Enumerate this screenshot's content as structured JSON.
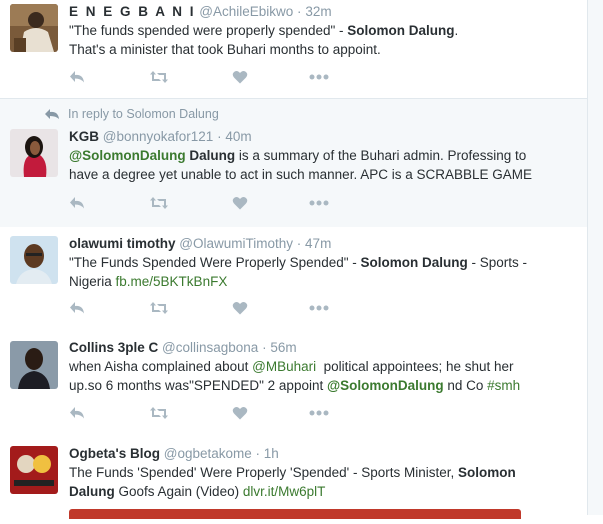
{
  "tweets": [
    {
      "name": "E N E G B A N I",
      "handle": "@AchileEbikwo",
      "dot": "·",
      "time": "32m",
      "lines": [
        {
          "parts": [
            {
              "t": "\"The funds spended were properly spended\" - "
            },
            {
              "b": "Solomon Dalung"
            },
            {
              "t": "."
            }
          ]
        },
        {
          "parts": [
            {
              "t": "That's a minister that took Buhari months to appoint."
            }
          ]
        }
      ]
    },
    {
      "reply_context": "In reply to Solomon Dalung",
      "name": "KGB",
      "handle": "@bonnyokafor121",
      "dot": "·",
      "time": "40m",
      "lines": [
        {
          "parts": [
            {
              "m": "@SolomonDalung"
            },
            {
              "t": " "
            },
            {
              "b": "Dalung"
            },
            {
              "t": " is a summary of the Buhari admin. Professing to"
            }
          ]
        },
        {
          "parts": [
            {
              "t": "have a degree yet unable to act in such manner. APC is a SCRABBLE GAME"
            }
          ]
        }
      ]
    },
    {
      "name": "olawumi timothy",
      "handle": "@OlawumiTimothy",
      "dot": "·",
      "time": "47m",
      "lines": [
        {
          "parts": [
            {
              "t": "\"The Funds Spended Were Properly Spended\" - "
            },
            {
              "b": "Solomon Dalung"
            },
            {
              "t": " - Sports -"
            }
          ]
        },
        {
          "parts": [
            {
              "t": "Nigeria "
            },
            {
              "l": "fb.me/5BKTkBnFX"
            }
          ]
        }
      ]
    },
    {
      "name": "Collins 3ple C",
      "handle": "@collinsagbona",
      "dot": "·",
      "time": "56m",
      "lines": [
        {
          "parts": [
            {
              "t": "when Aisha complained about "
            },
            {
              "l": "@MBuhari"
            },
            {
              "t": "  political appointees; he shut her"
            }
          ]
        },
        {
          "parts": [
            {
              "t": "up.so 6 months was\"SPENDED\" 2 appoint "
            },
            {
              "m": "@SolomonDalung"
            },
            {
              "t": " nd Co "
            },
            {
              "l": "#smh"
            }
          ]
        }
      ]
    },
    {
      "name": "Ogbeta's Blog",
      "handle": "@ogbetakome",
      "dot": "·",
      "time": "1h",
      "lines": [
        {
          "parts": [
            {
              "t": "The Funds 'Spended' Were Properly 'Spended' - Sports Minister, "
            },
            {
              "b": "Solomon"
            }
          ]
        },
        {
          "parts": [
            {
              "b": "Dalung"
            },
            {
              "t": " Goofs Again (Video) "
            },
            {
              "l": "dlvr.it/Mw6plT"
            }
          ]
        }
      ]
    }
  ],
  "icons": {
    "reply": "reply-icon",
    "retweet": "retweet-icon",
    "like": "heart-icon",
    "more": "more-icon"
  },
  "colors": {
    "link": "#3b7a2f",
    "icon": "#aab8c2",
    "muted": "#8899a6"
  }
}
